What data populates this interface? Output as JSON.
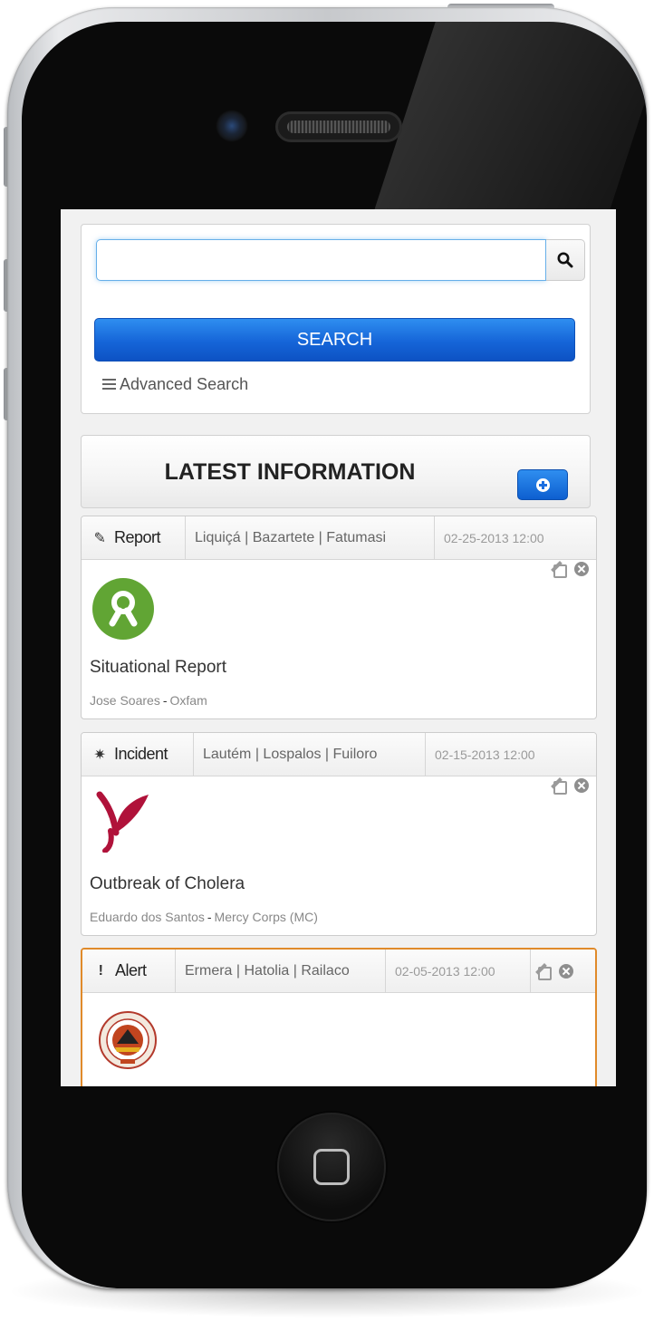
{
  "search": {
    "value": "",
    "placeholder": "",
    "button_label": "SEARCH",
    "advanced_label": "Advanced Search"
  },
  "latest": {
    "title": "LATEST INFORMATION"
  },
  "colors": {
    "primary_button": "#1565d8",
    "alert_border": "#e08a2a",
    "oxfam_green": "#61a534",
    "mercy_red": "#b0123a"
  },
  "cards": [
    {
      "type": "Report",
      "type_icon": "pencil-icon",
      "location": "Liquiçá | Bazartete | Fatumasi",
      "date": "02-25-2013 12:00",
      "logo": "oxfam-logo",
      "title": "Situational Report",
      "author": "Jose Soares",
      "organization": "Oxfam"
    },
    {
      "type": "Incident",
      "type_icon": "asterisk-icon",
      "location": "Lautém | Lospalos | Fuiloro",
      "date": "02-15-2013 12:00",
      "logo": "mercy-corps-logo",
      "title": "Outbreak of Cholera",
      "author": "Eduardo dos Santos",
      "organization": "Mercy Corps (MC)"
    },
    {
      "type": "Alert",
      "type_icon": "exclamation-icon",
      "location": "Ermera | Hatolia | Railaco",
      "date": "02-05-2013 12:00",
      "logo": "government-seal-logo"
    }
  ]
}
